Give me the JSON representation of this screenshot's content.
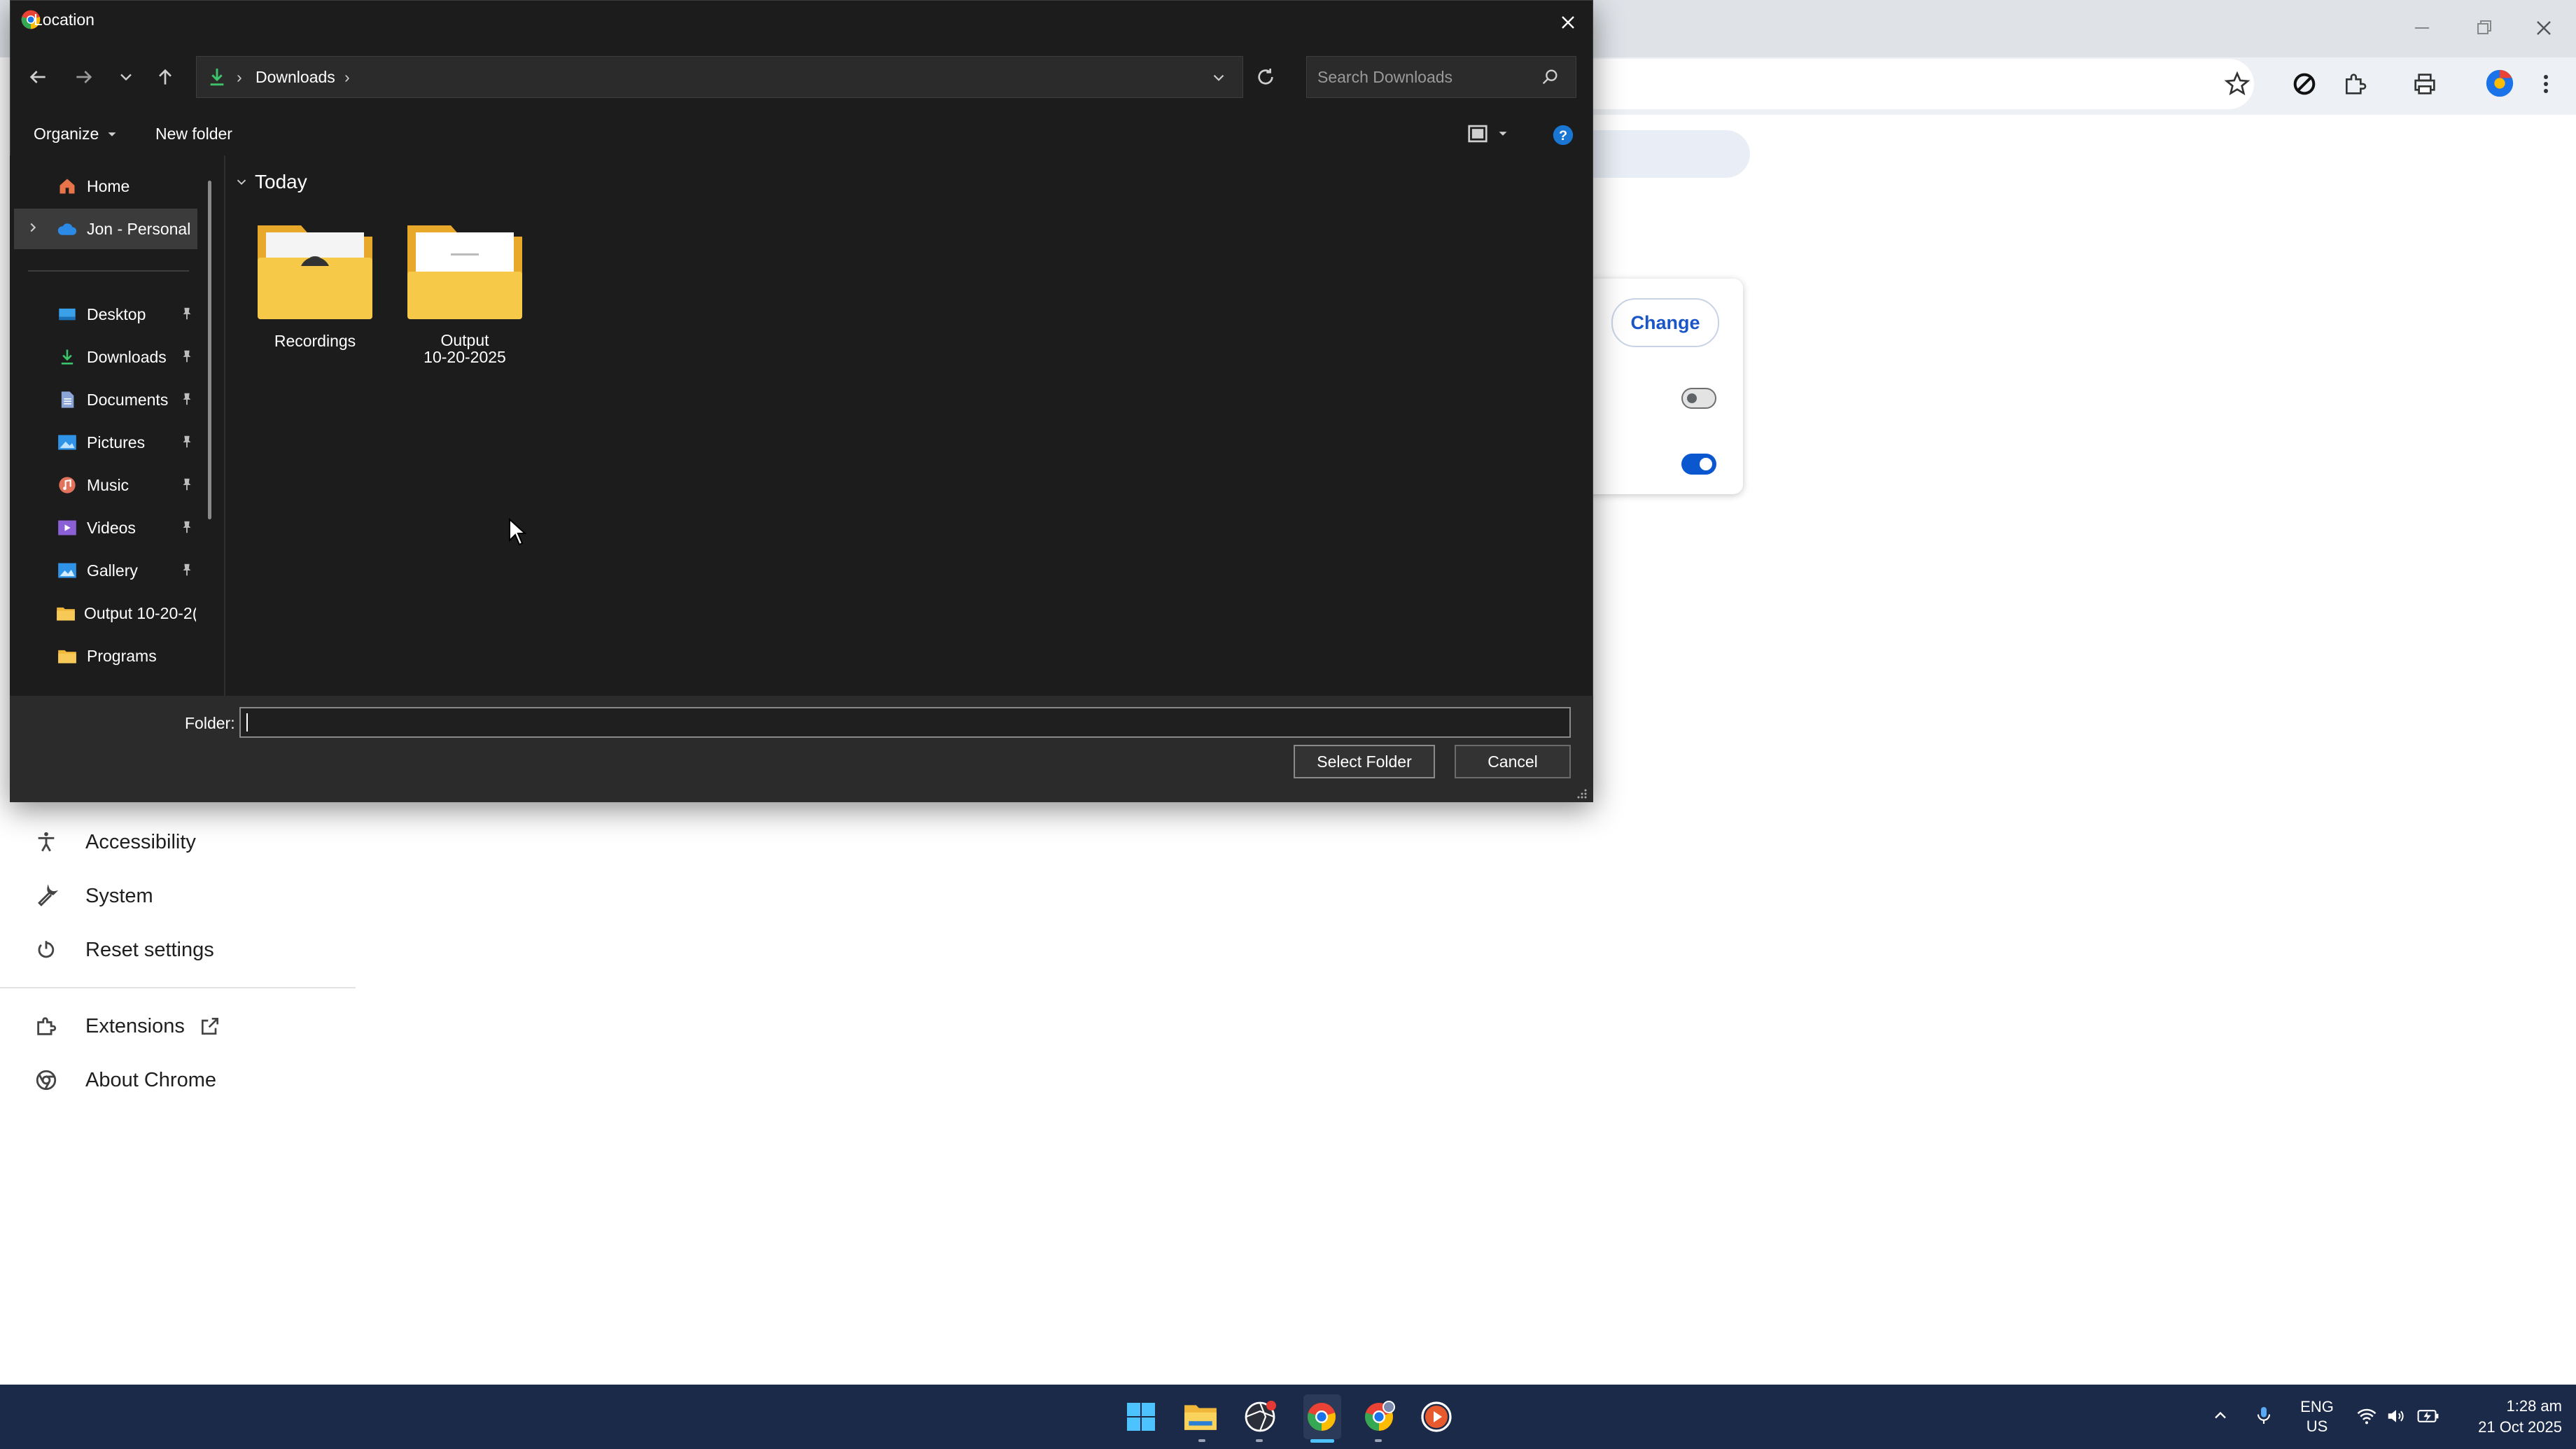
{
  "dialog": {
    "title": "Location",
    "address": {
      "segments": [
        "Downloads"
      ]
    },
    "search_placeholder": "Search Downloads",
    "toolbar": {
      "organize": "Organize",
      "new_folder": "New folder"
    },
    "nav": [
      {
        "label": "Home",
        "icon": "home-icon",
        "pinned": false
      },
      {
        "label": "Jon - Personal",
        "icon": "cloud-icon",
        "pinned": false,
        "selected": true
      },
      {
        "label": "Desktop",
        "icon": "desktop-icon",
        "pinned": true
      },
      {
        "label": "Downloads",
        "icon": "download-icon",
        "pinned": true
      },
      {
        "label": "Documents",
        "icon": "document-icon",
        "pinned": true
      },
      {
        "label": "Pictures",
        "icon": "picture-icon",
        "pinned": true
      },
      {
        "label": "Music",
        "icon": "music-icon",
        "pinned": true
      },
      {
        "label": "Videos",
        "icon": "video-icon",
        "pinned": true
      },
      {
        "label": "Gallery",
        "icon": "gallery-icon",
        "pinned": true
      },
      {
        "label": "Output 10-20-2(",
        "icon": "folder-icon",
        "pinned": false
      },
      {
        "label": "Programs",
        "icon": "folder-icon",
        "pinned": false
      }
    ],
    "group_header": "Today",
    "items": [
      {
        "name": "Recordings"
      },
      {
        "name_line1": "Output",
        "name_line2": "10-20-2025"
      }
    ],
    "folder_label": "Folder:",
    "folder_value": "",
    "select_button": "Select Folder",
    "cancel_button": "Cancel"
  },
  "settings": {
    "change_button": "Change",
    "toggles": {
      "first": false,
      "second": true
    },
    "sidebar": [
      {
        "label": "Accessibility",
        "icon": "accessibility-icon"
      },
      {
        "label": "System",
        "icon": "wrench-icon"
      },
      {
        "label": "Reset settings",
        "icon": "reset-icon"
      },
      {
        "label": "Extensions",
        "icon": "puzzle-icon"
      },
      {
        "label": "About Chrome",
        "icon": "chrome-icon"
      }
    ]
  },
  "taskbar": {
    "language": "ENG",
    "region": "US",
    "time": "1:28 am",
    "date": "21 Oct 2025"
  },
  "colors": {
    "accent": "#0b57d0",
    "taskbar": "#1b2a48",
    "dialog_bg": "#1c1c1c",
    "folder": "#f5c542"
  }
}
